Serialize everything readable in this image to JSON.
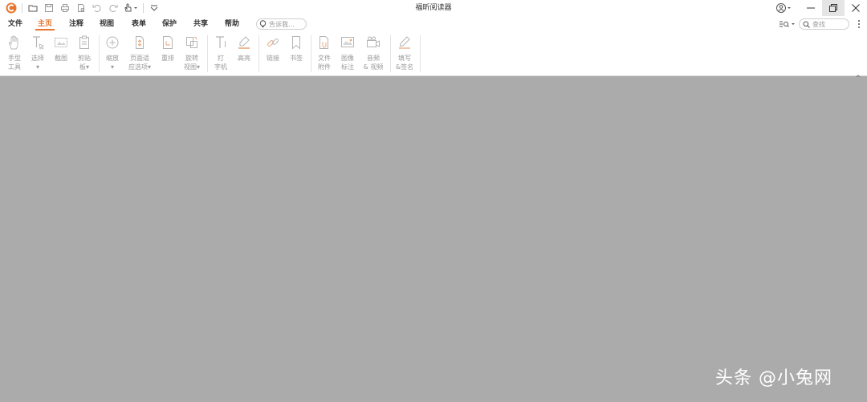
{
  "app": {
    "title": "福昕阅读器",
    "brand_color": "#e7752d"
  },
  "quick_access": {
    "icons": [
      "foxit-logo-icon",
      "open-folder-icon",
      "save-icon",
      "print-icon",
      "document-icon",
      "undo-icon",
      "redo-icon",
      "hand-tool-icon",
      "customize-icon"
    ]
  },
  "menu": {
    "tabs": [
      "文件",
      "主页",
      "注释",
      "视图",
      "表单",
      "保护",
      "共享",
      "帮助"
    ],
    "active_tab": "主页",
    "tell_me_placeholder": "告诉我...",
    "search_placeholder": "查找"
  },
  "ribbon": {
    "hand_tool": [
      "手型",
      "工具"
    ],
    "select": [
      "选择"
    ],
    "snapshot": [
      "截图"
    ],
    "clipboard": [
      "剪贴",
      "板▾"
    ],
    "zoom": [
      "缩放"
    ],
    "page_fit": [
      "页面适",
      "应选项▾"
    ],
    "reflow": [
      "重排"
    ],
    "rotate": [
      "旋转",
      "视图▾"
    ],
    "typewriter": [
      "打",
      "字机"
    ],
    "highlight": [
      "高亮"
    ],
    "link": [
      "链接"
    ],
    "bookmark": [
      "书签"
    ],
    "file_attachment": [
      "文件",
      "附件"
    ],
    "image_annotation": [
      "图像",
      "标注"
    ],
    "audio_video": [
      "音频",
      "& 视频"
    ],
    "fill_sign": [
      "填写",
      "&签名"
    ]
  },
  "watermark": {
    "text": "头条 @小兔网"
  }
}
